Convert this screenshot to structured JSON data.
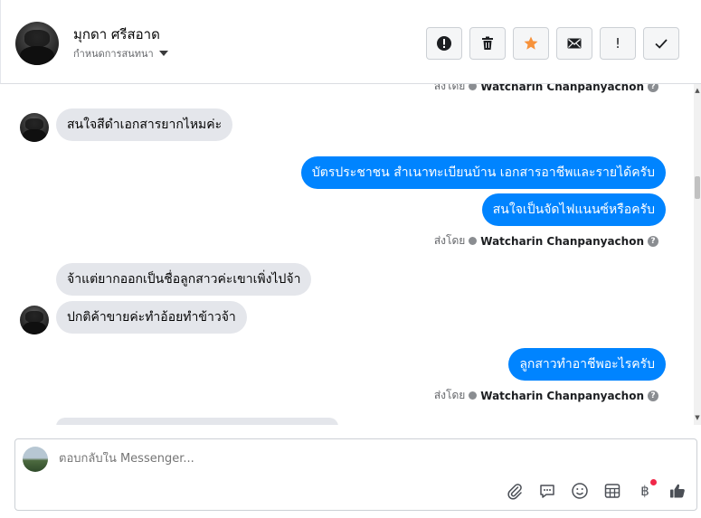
{
  "header": {
    "name": "มุกดา ศรีสอาด",
    "subtitle": "กำหนดการสนทนา",
    "toolbar": [
      {
        "name": "report-icon",
        "label": ""
      },
      {
        "name": "trash-icon",
        "label": ""
      },
      {
        "name": "star-icon",
        "label": ""
      },
      {
        "name": "envelope-icon",
        "label": ""
      },
      {
        "name": "exclamation-icon",
        "label": "!"
      },
      {
        "name": "check-icon",
        "label": ""
      }
    ],
    "colors": {
      "star": "#f7923b"
    }
  },
  "thread": {
    "sent_by_prefix": "ส่งโดย",
    "sent_by_name": "Watcharin Chanpanyachon",
    "messages": [
      {
        "direction": "in",
        "text": "สนใจสีดำเอกสารยากไหมค่ะ"
      },
      {
        "direction": "out",
        "text": "บัตรประชาชน สำเนาทะเบียนบ้าน เอกสารอาชีพและรายได้ครับ"
      },
      {
        "direction": "out",
        "text": "สนใจเป็นจัดไฟแนนซ์หรือครับ"
      },
      {
        "direction": "in",
        "text": "จ้าแต่ยากออกเป็นชื่อลูกสาวค่ะเขาเพิ่งไปจ้า"
      },
      {
        "direction": "in",
        "text": "ปกติค้าขายค่ะทำอ้อยทำข้าวจ้า"
      },
      {
        "direction": "out",
        "text": "ลูกสาวทำอาชีพอะไรครับ"
      }
    ],
    "colors": {
      "incoming": "#e4e6eb",
      "outgoing": "#0084ff"
    }
  },
  "composer": {
    "placeholder": "ตอบกลับใน Messenger...",
    "tools": [
      "paperclip-icon",
      "speech-bubble-icon",
      "smiley-icon",
      "table-icon",
      "baht-icon",
      "thumbs-up-icon"
    ],
    "baht_symbol": "฿"
  }
}
